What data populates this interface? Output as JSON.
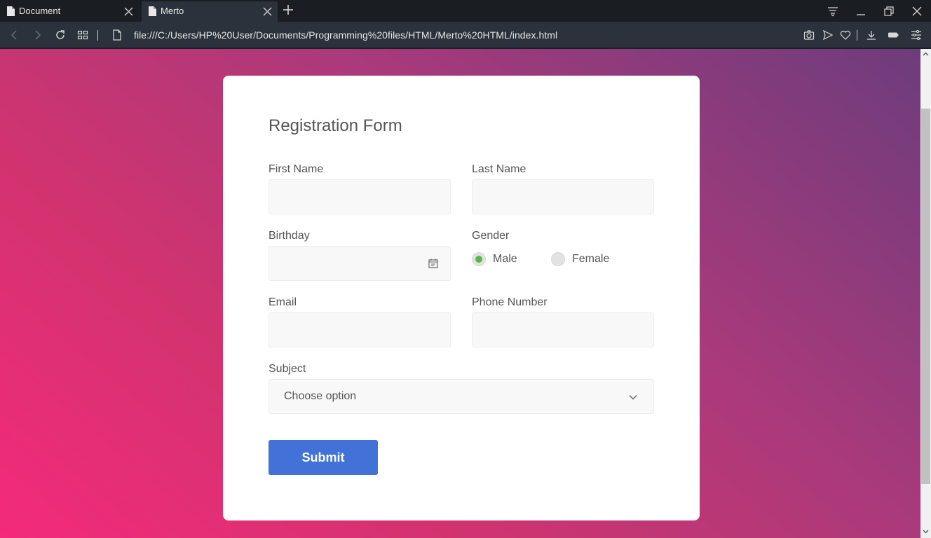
{
  "tabs": [
    {
      "title": "Document",
      "active": false
    },
    {
      "title": "Merto",
      "active": true
    }
  ],
  "address_bar": {
    "url": "file:///C:/Users/HP%20User/Documents/Programming%20files/HTML/Merto%20HTML/index.html"
  },
  "form": {
    "title": "Registration Form",
    "first_name_label": "First Name",
    "last_name_label": "Last Name",
    "birthday_label": "Birthday",
    "gender_label": "Gender",
    "gender_options": [
      "Male",
      "Female"
    ],
    "gender_selected": "Male",
    "email_label": "Email",
    "phone_label": "Phone Number",
    "subject_label": "Subject",
    "subject_placeholder": "Choose option",
    "submit_label": "Submit"
  },
  "colors": {
    "accent": "#4272d7",
    "radio_checked": "#57b846",
    "gradient_start": "#f42a7b",
    "gradient_end": "#6d3c7c"
  }
}
